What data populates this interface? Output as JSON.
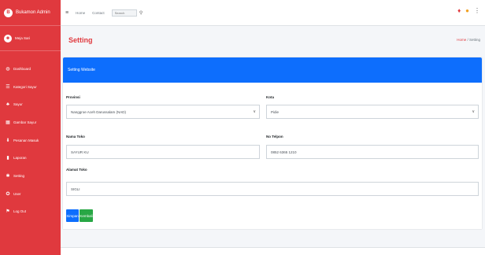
{
  "brand": {
    "logo_letter": "B",
    "title": "Bukamon Admin"
  },
  "user": {
    "avatar_glyph": "☻",
    "name": "Meja Sari"
  },
  "sidebar": {
    "items": [
      {
        "icon": "dashboard-icon",
        "glyph": "◍",
        "label": "Dashboard"
      },
      {
        "icon": "list-icon",
        "glyph": "☰",
        "label": "Kategori Sayur"
      },
      {
        "icon": "leaf-icon",
        "glyph": "♣",
        "label": "Sayur"
      },
      {
        "icon": "image-icon",
        "glyph": "▦",
        "label": "Gambar Sayur"
      },
      {
        "icon": "inbox-icon",
        "glyph": "⬇",
        "label": "Pesanan Masuk"
      },
      {
        "icon": "report-icon",
        "glyph": "▮",
        "label": "Laporan"
      },
      {
        "icon": "gear-icon",
        "glyph": "✱",
        "label": "Setting"
      },
      {
        "icon": "users-icon",
        "glyph": "✪",
        "label": "User"
      },
      {
        "icon": "logout-icon",
        "glyph": "⚑",
        "label": "Log Out"
      }
    ]
  },
  "navbar": {
    "toggle_glyph": "≡",
    "links": [
      "Home",
      "Contact"
    ],
    "search_placeholder": "Search",
    "search_glyph": "⚲",
    "right_icons": [
      {
        "name": "bell-icon",
        "glyph": "♦"
      },
      {
        "name": "user-icon",
        "glyph": "●"
      },
      {
        "name": "menu-icon",
        "glyph": "⋮"
      }
    ]
  },
  "page": {
    "title": "Setting",
    "breadcrumb_home": "Home",
    "breadcrumb_sep": " / ",
    "breadcrumb_current": "Setting"
  },
  "card": {
    "header": "Setting Website",
    "provinsi": {
      "label": "Provinsi",
      "value": "Nanggroe Aceh Darussalam (NAD)"
    },
    "kota": {
      "label": "Kota",
      "value": "Pidie"
    },
    "nama_toko": {
      "label": "Nama Toko",
      "value": "SAYUR KU"
    },
    "no_telpon": {
      "label": "No Telpon",
      "value": "0852 6365 1210"
    },
    "alamat_toko": {
      "label": "Alamat Toko",
      "value": "SIGLI"
    },
    "buttons": {
      "simpan": "Simpan",
      "kembali": "Kembali"
    }
  },
  "colors": {
    "sidebar": "#e0393e",
    "primary": "#0d6efd",
    "success": "#28a745"
  }
}
